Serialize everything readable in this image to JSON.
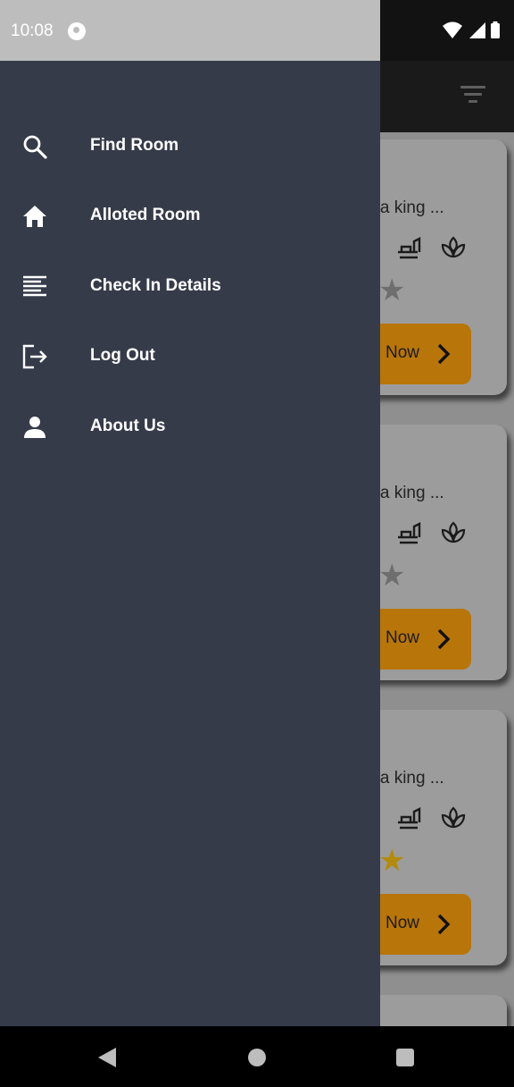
{
  "status_bar": {
    "time": "10:08"
  },
  "drawer": {
    "items": [
      {
        "label": "Find Room",
        "icon": "search-icon"
      },
      {
        "label": "Alloted Room",
        "icon": "home-icon"
      },
      {
        "label": "Check In Details",
        "icon": "notes-icon"
      },
      {
        "label": "Log Out",
        "icon": "logout-icon"
      },
      {
        "label": "About Us",
        "icon": "person-icon"
      }
    ]
  },
  "background_cards": [
    {
      "description": "n a king ...",
      "button_label": "Now",
      "star_color": "#6e6e6e"
    },
    {
      "description": "n a king ...",
      "button_label": "Now",
      "star_color": "#6e6e6e"
    },
    {
      "description": "n a king ...",
      "button_label": "Now",
      "star_color": "#b38a0b"
    }
  ],
  "colors": {
    "drawer_bg": "#363b4a",
    "scrim_bg": "#8f8f8f",
    "button_accent": "#b8750a"
  }
}
